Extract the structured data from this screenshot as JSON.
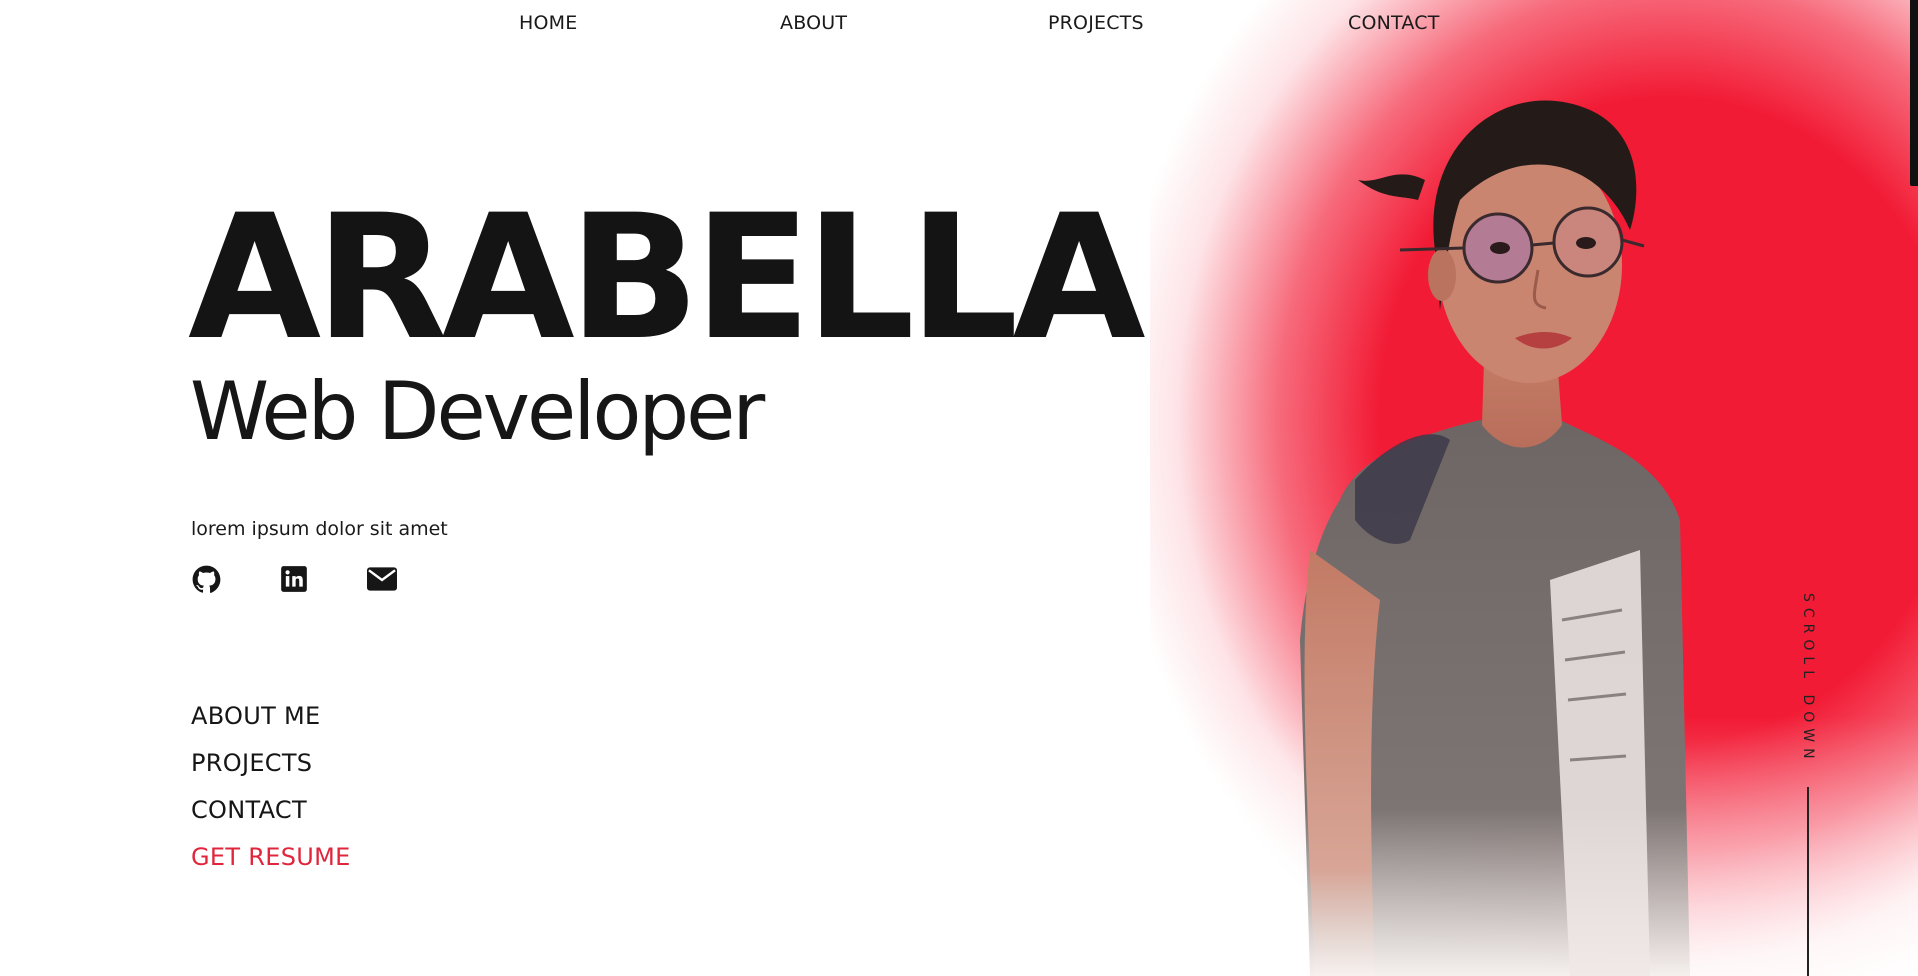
{
  "nav": {
    "home": "HOME",
    "about": "ABOUT",
    "projects": "PROJECTS",
    "contact": "CONTACT"
  },
  "hero": {
    "name": "ARABELLA",
    "role": "Web Developer",
    "tagline": "lorem ipsum dolor sit amet"
  },
  "social": {
    "icons": [
      "github-icon",
      "linkedin-icon",
      "envelope-icon"
    ]
  },
  "menu": {
    "about_me": "ABOUT ME",
    "projects": "PROJECTS",
    "contact": "CONTACT",
    "resume": "GET RESUME"
  },
  "scroll": {
    "label": "SCROLL DOWN"
  },
  "colors": {
    "accent": "#f21b35",
    "resume_link": "#e0263d",
    "text": "#161616"
  }
}
